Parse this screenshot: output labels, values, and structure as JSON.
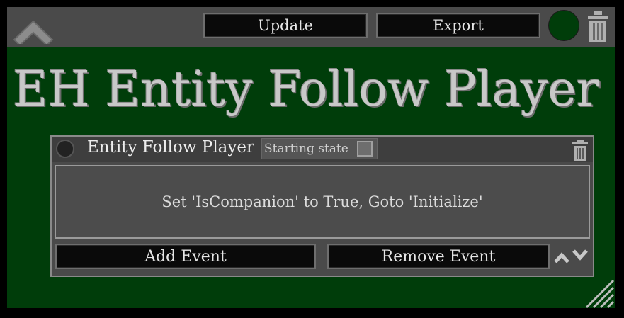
{
  "toolbar": {
    "update_label": "Update",
    "export_label": "Export",
    "collapse_icon": "chevron-up-icon",
    "status_color": "#003d0a",
    "delete_icon": "trash-icon"
  },
  "title": "EH Entity Follow Player",
  "state_card": {
    "name": "Entity Follow Player",
    "starting_state_label": "Starting state",
    "starting_state_checked": false,
    "events": [
      {
        "text": "Set 'IsCompanion' to True, Goto 'Initialize'"
      }
    ],
    "add_event_label": "Add Event",
    "remove_event_label": "Remove Event",
    "move_icons": [
      "chevron-up-icon",
      "chevron-down-icon"
    ]
  },
  "colors": {
    "panel_background": "#003d0a",
    "toolbar_background": "#4a4a4a",
    "card_background": "#4a4a4a",
    "button_background": "#0a0a0a"
  }
}
